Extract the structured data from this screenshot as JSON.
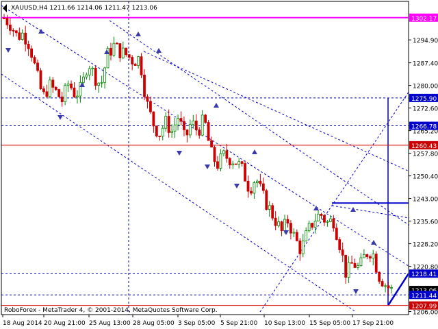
{
  "chart_data": {
    "type": "candlestick",
    "header": {
      "symbol": "XAUUSD,H4",
      "open": "1211.66",
      "high": "1214.06",
      "low": "1211.47",
      "close": "1213.06"
    },
    "ylim": [
      1205.0,
      1307.5
    ],
    "y_ticks": [
      "1294.90",
      "1287.40",
      "1280.00",
      "1272.60",
      "1265.20",
      "1257.80",
      "1250.40",
      "1243.00",
      "1235.60",
      "1228.20",
      "1220.80",
      "1206.00"
    ],
    "x_tick_labels": [
      "18 Aug 2014",
      "20 Aug 21:00",
      "25 Aug 13:00",
      "28 Aug 05:00",
      "3 Sep 05:00",
      "5 Sep 21:00",
      "10 Sep 13:00",
      "15 Sep 05:00",
      "17 Sep 21:00"
    ],
    "price_labels": [
      {
        "value": 1302.17,
        "text": "1302.17",
        "color": "#ff00ff"
      },
      {
        "value": 1275.9,
        "text": "1275.90",
        "color": "#0000cc"
      },
      {
        "value": 1266.78,
        "text": "1266.78",
        "color": "#0000cc"
      },
      {
        "value": 1260.43,
        "text": "1260.43",
        "color": "#cc0000"
      },
      {
        "value": 1218.41,
        "text": "1218.41",
        "color": "#0000cc"
      },
      {
        "value": 1213.06,
        "text": "1213.06",
        "color": "#000000"
      },
      {
        "value": 1211.44,
        "text": "1211.44",
        "color": "#0000cc"
      },
      {
        "value": 1207.99,
        "text": "1207.99",
        "color": "#cc0000"
      }
    ],
    "horizontal_lines": [
      {
        "value": 1302.17,
        "color": "#ff00ff",
        "style": "solid",
        "width": 2
      },
      {
        "value": 1275.9,
        "color": "#0000aa",
        "style": "dashed",
        "width": 1
      },
      {
        "value": 1266.78,
        "color": "#0000aa",
        "style": "dashed",
        "width": 1
      },
      {
        "value": 1260.43,
        "color": "#dd0000",
        "style": "solid",
        "width": 1
      },
      {
        "value": 1218.41,
        "color": "#0000aa",
        "style": "dashed",
        "width": 1
      },
      {
        "value": 1211.44,
        "color": "#0000aa",
        "style": "dashed",
        "width": 1
      },
      {
        "value": 1207.99,
        "color": "#dd0000",
        "style": "solid",
        "width": 1
      }
    ],
    "close_path": [
      1302,
      1300,
      1296,
      1297,
      1293,
      1284,
      1276,
      1280,
      1278,
      1275,
      1281,
      1277,
      1279,
      1288,
      1283,
      1280,
      1290,
      1293,
      1291,
      1290,
      1288,
      1289,
      1275,
      1268,
      1264,
      1268,
      1265,
      1270,
      1262,
      1268,
      1265,
      1269,
      1258,
      1254,
      1257,
      1256,
      1255,
      1252,
      1246,
      1250,
      1244,
      1240,
      1236,
      1232,
      1236,
      1230,
      1226,
      1232,
      1236,
      1238,
      1235,
      1236,
      1228,
      1218,
      1222,
      1220,
      1225,
      1226,
      1218,
      1215,
      1213
    ],
    "colors": {
      "up": "#008800",
      "down": "#cc0000",
      "text": "#000000",
      "axis_bg": "#ffffff",
      "axis_text": "#000000",
      "channel": "#0000cc",
      "label_bg": "#0000aa"
    },
    "footer": "RoboForex - MetaTrader 4, © 2001-2014, MetaQuotes Software Corp."
  }
}
